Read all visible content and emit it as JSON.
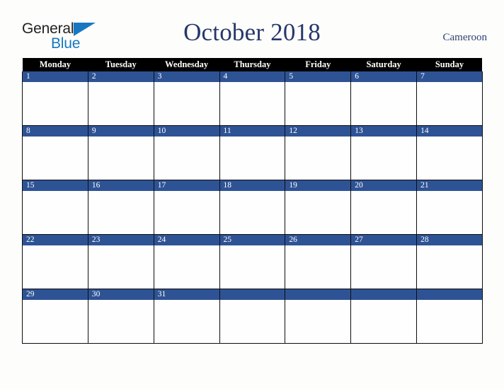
{
  "logo": {
    "word_one": "General",
    "word_two": "Blue",
    "triangle_icon": "triangle-icon",
    "brand_black": "#221f1f",
    "brand_blue": "#1678c2"
  },
  "header": {
    "title": "October 2018",
    "country": "Cameroon",
    "title_color": "#27376b"
  },
  "calendar": {
    "weekday_headers": [
      "Monday",
      "Tuesday",
      "Wednesday",
      "Thursday",
      "Friday",
      "Saturday",
      "Sunday"
    ],
    "header_background": "#000000",
    "header_text_color": "#ffffff",
    "day_bar_background": "#2e5395",
    "day_bar_text_color": "#ffffff",
    "cell_background": "#ffffff",
    "border_color": "#0d0d0d",
    "weeks": [
      {
        "days": [
          {
            "number": "1"
          },
          {
            "number": "2"
          },
          {
            "number": "3"
          },
          {
            "number": "4"
          },
          {
            "number": "5"
          },
          {
            "number": "6"
          },
          {
            "number": "7"
          }
        ]
      },
      {
        "days": [
          {
            "number": "8"
          },
          {
            "number": "9"
          },
          {
            "number": "10"
          },
          {
            "number": "11"
          },
          {
            "number": "12"
          },
          {
            "number": "13"
          },
          {
            "number": "14"
          }
        ]
      },
      {
        "days": [
          {
            "number": "15"
          },
          {
            "number": "16"
          },
          {
            "number": "17"
          },
          {
            "number": "18"
          },
          {
            "number": "19"
          },
          {
            "number": "20"
          },
          {
            "number": "21"
          }
        ]
      },
      {
        "days": [
          {
            "number": "22"
          },
          {
            "number": "23"
          },
          {
            "number": "24"
          },
          {
            "number": "25"
          },
          {
            "number": "26"
          },
          {
            "number": "27"
          },
          {
            "number": "28"
          }
        ]
      },
      {
        "days": [
          {
            "number": "29"
          },
          {
            "number": "30"
          },
          {
            "number": "31"
          },
          {
            "number": ""
          },
          {
            "number": ""
          },
          {
            "number": ""
          },
          {
            "number": ""
          }
        ]
      }
    ]
  }
}
